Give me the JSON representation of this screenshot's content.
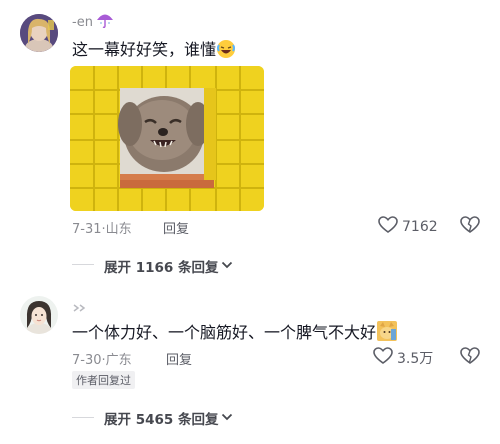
{
  "comments": [
    {
      "username": "-en",
      "text": "这一幕好好笑，谁懂",
      "date": "7-31",
      "location": "山东",
      "reply_label": "回复",
      "likes": "7162",
      "expand_label": "展开 1166 条回复"
    },
    {
      "username": "",
      "text": "一个体力好、一个脑筋好、一个脾气不大好",
      "date": "7-30",
      "location": "广东",
      "reply_label": "回复",
      "likes": "3.5万",
      "author_badge": "作者回复过",
      "expand_label": "展开 5465 条回复"
    }
  ],
  "colors": {
    "tile_yellow": "#f4d424",
    "text_primary": "#161823",
    "text_meta": "#8a8b91"
  }
}
